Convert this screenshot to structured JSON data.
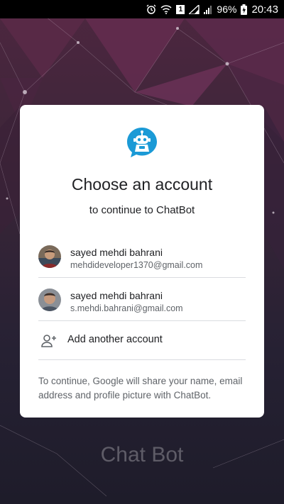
{
  "status_bar": {
    "battery_percent": "96%",
    "time": "20:43",
    "sim_label": "1"
  },
  "dialog": {
    "title": "Choose an account",
    "subtitle": "to continue to ChatBot",
    "accounts": [
      {
        "name": "sayed mehdi bahrani",
        "email": "mehdideveloper1370@gmail.com"
      },
      {
        "name": "sayed mehdi bahrani",
        "email": "s.mehdi.bahrani@gmail.com"
      }
    ],
    "add_account_label": "Add another account",
    "note": "To continue, Google will share your name, email address and profile picture with ChatBot.",
    "logo_icon": "chatbot-robot-icon",
    "add_icon": "person-add-icon"
  },
  "background": {
    "brand_text": "Chat Bot"
  },
  "colors": {
    "dialog_bg": "#ffffff",
    "logo_blue": "#1b9ad6",
    "primary_text": "#202124",
    "secondary_text": "#5f6368"
  }
}
